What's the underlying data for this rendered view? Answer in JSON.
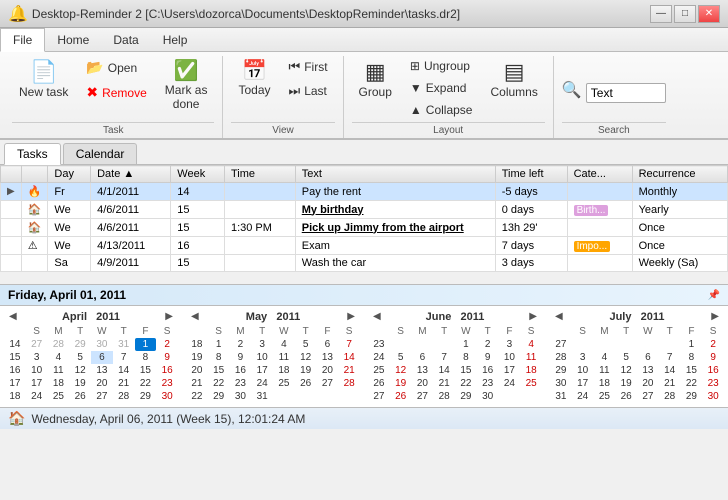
{
  "titleBar": {
    "icon": "🔔",
    "title": "Desktop-Reminder 2 [C:\\Users\\dozorca\\Documents\\DesktopReminder\\tasks.dr2]",
    "minimize": "—",
    "maximize": "□",
    "close": "✕"
  },
  "menuBar": {
    "items": [
      "File",
      "Home",
      "Data",
      "Help"
    ],
    "active": "Home"
  },
  "ribbon": {
    "groups": [
      {
        "label": "Task",
        "buttons": [
          {
            "id": "new-task",
            "icon": "📄",
            "label": "New task"
          },
          {
            "id": "open",
            "icon": "📂",
            "label": "Open",
            "small": true
          },
          {
            "id": "remove",
            "icon": "✖",
            "label": "Remove",
            "small": true,
            "color": "red"
          },
          {
            "id": "mark-done",
            "icon": "✔",
            "label": "Mark as done",
            "large": true
          }
        ]
      },
      {
        "label": "View",
        "buttons": [
          {
            "id": "today",
            "icon": "📅",
            "label": "Today",
            "large": true
          },
          {
            "id": "first",
            "icon": "⏮",
            "label": "First",
            "small": true
          },
          {
            "id": "last",
            "icon": "⏭",
            "label": "Last",
            "small": true
          }
        ]
      },
      {
        "label": "Layout",
        "buttons": [
          {
            "id": "group",
            "icon": "▦",
            "label": "Group",
            "large": true
          },
          {
            "id": "ungroup",
            "icon": "⊞",
            "label": "Ungroup",
            "small": true
          },
          {
            "id": "expand",
            "label": "Expand",
            "small": true
          },
          {
            "id": "collapse",
            "label": "Collapse",
            "small": true
          },
          {
            "id": "columns",
            "icon": "▤",
            "label": "Columns",
            "large": true
          }
        ]
      },
      {
        "label": "Search",
        "searchLabel": "Text",
        "searchPlaceholder": "Text"
      }
    ]
  },
  "tabs": [
    "Tasks",
    "Calendar"
  ],
  "activeTab": "Tasks",
  "tableHeaders": [
    "",
    "Day",
    "Date",
    "Week",
    "Time",
    "Text",
    "Time left",
    "Cate...",
    "Recurrence"
  ],
  "tasks": [
    {
      "indicator": "▶",
      "icon": "🔥",
      "day": "Fr",
      "date": "4/1/2011",
      "week": "14",
      "time": "",
      "text": "Pay the rent",
      "timeLeft": "-5 days",
      "category": "",
      "recurrence": "Monthly",
      "selected": true
    },
    {
      "indicator": "",
      "icon": "🏠",
      "day": "We",
      "date": "4/6/2011",
      "week": "15",
      "time": "",
      "text": "My birthday",
      "timeLeft": "0 days",
      "category": "Birth...",
      "recurrence": "Yearly",
      "bold": true,
      "underline": true
    },
    {
      "indicator": "",
      "icon": "🏠",
      "day": "We",
      "date": "4/6/2011",
      "week": "15",
      "time": "1:30 PM",
      "text": "Pick up Jimmy from the airport",
      "timeLeft": "13h 29'",
      "category": "",
      "recurrence": "Once",
      "bold": true,
      "underline": true
    },
    {
      "indicator": "",
      "icon": "⚠",
      "day": "We",
      "date": "4/13/2011",
      "week": "16",
      "time": "",
      "text": "Exam",
      "timeLeft": "7 days",
      "category": "Impo...",
      "recurrence": "Once"
    },
    {
      "indicator": "",
      "icon": "",
      "day": "Sa",
      "date": "4/9/2011",
      "week": "15",
      "time": "",
      "text": "Wash the car",
      "timeLeft": "3 days",
      "category": "",
      "recurrence": "Weekly (Sa)"
    }
  ],
  "calendarHeader": "Friday, April 01, 2011",
  "calendars": [
    {
      "month": "April",
      "year": "2011",
      "weekHeader": [
        "S",
        "M",
        "T",
        "W",
        "T",
        "F",
        "S"
      ],
      "weeks": [
        {
          "wn": "14",
          "days": [
            {
              "d": "27",
              "om": true
            },
            {
              "d": "28",
              "om": true
            },
            {
              "d": "29",
              "om": true
            },
            {
              "d": "30",
              "om": true
            },
            {
              "d": "31",
              "om": true
            },
            {
              "d": "1",
              "today": true
            },
            {
              "d": "2",
              "weekend": true
            }
          ]
        },
        {
          "wn": "15",
          "days": [
            {
              "d": "3"
            },
            {
              "d": "4"
            },
            {
              "d": "5"
            },
            {
              "d": "6",
              "sel": true
            },
            {
              "d": "7"
            },
            {
              "d": "8"
            },
            {
              "d": "9",
              "weekend": true
            }
          ]
        },
        {
          "wn": "16",
          "days": [
            {
              "d": "10"
            },
            {
              "d": "11"
            },
            {
              "d": "12"
            },
            {
              "d": "13"
            },
            {
              "d": "14"
            },
            {
              "d": "15"
            },
            {
              "d": "16",
              "weekend": true
            }
          ]
        },
        {
          "wn": "17",
          "days": [
            {
              "d": "17"
            },
            {
              "d": "18"
            },
            {
              "d": "19"
            },
            {
              "d": "20"
            },
            {
              "d": "21"
            },
            {
              "d": "22"
            },
            {
              "d": "23",
              "weekend": true
            }
          ]
        },
        {
          "wn": "18",
          "days": [
            {
              "d": "24"
            },
            {
              "d": "25"
            },
            {
              "d": "26"
            },
            {
              "d": "27"
            },
            {
              "d": "28"
            },
            {
              "d": "29"
            },
            {
              "d": "30",
              "weekend": true
            }
          ]
        }
      ]
    },
    {
      "month": "May",
      "year": "2011",
      "weekHeader": [
        "S",
        "M",
        "T",
        "W",
        "T",
        "F",
        "S"
      ],
      "weeks": [
        {
          "wn": "18",
          "days": [
            {
              "d": "1"
            },
            {
              "d": "2"
            },
            {
              "d": "3"
            },
            {
              "d": "4"
            },
            {
              "d": "5"
            },
            {
              "d": "6"
            },
            {
              "d": "7",
              "weekend": true
            }
          ]
        },
        {
          "wn": "19",
          "days": [
            {
              "d": "8"
            },
            {
              "d": "9"
            },
            {
              "d": "10"
            },
            {
              "d": "11"
            },
            {
              "d": "12"
            },
            {
              "d": "13"
            },
            {
              "d": "14",
              "weekend": true
            }
          ]
        },
        {
          "wn": "20",
          "days": [
            {
              "d": "15"
            },
            {
              "d": "16"
            },
            {
              "d": "17"
            },
            {
              "d": "18"
            },
            {
              "d": "19"
            },
            {
              "d": "20"
            },
            {
              "d": "21",
              "weekend": true
            }
          ]
        },
        {
          "wn": "21",
          "days": [
            {
              "d": "22"
            },
            {
              "d": "23"
            },
            {
              "d": "24"
            },
            {
              "d": "25"
            },
            {
              "d": "26"
            },
            {
              "d": "27"
            },
            {
              "d": "28",
              "weekend": true
            }
          ]
        },
        {
          "wn": "22",
          "days": [
            {
              "d": "29"
            },
            {
              "d": "30"
            },
            {
              "d": "31"
            },
            {
              "d": "",
              "om": true
            },
            {
              "d": "",
              "om": true
            },
            {
              "d": "",
              "om": true
            },
            {
              "d": "",
              "om": true
            }
          ]
        }
      ]
    },
    {
      "month": "June",
      "year": "2011",
      "weekHeader": [
        "S",
        "M",
        "T",
        "W",
        "T",
        "F",
        "S"
      ],
      "weeks": [
        {
          "wn": "23",
          "days": [
            {
              "d": ""
            },
            {
              "d": ""
            },
            {
              "d": ""
            },
            {
              "d": "1"
            },
            {
              "d": "2"
            },
            {
              "d": "3"
            },
            {
              "d": "4",
              "weekend": true
            }
          ]
        },
        {
          "wn": "24",
          "days": [
            {
              "d": "5"
            },
            {
              "d": "6"
            },
            {
              "d": "7"
            },
            {
              "d": "8"
            },
            {
              "d": "9"
            },
            {
              "d": "10"
            },
            {
              "d": "11",
              "weekend": true
            }
          ]
        },
        {
          "wn": "25",
          "days": [
            {
              "d": "12",
              "weekend": true
            },
            {
              "d": "13"
            },
            {
              "d": "14"
            },
            {
              "d": "15"
            },
            {
              "d": "16"
            },
            {
              "d": "17"
            },
            {
              "d": "18",
              "weekend": true
            }
          ]
        },
        {
          "wn": "26",
          "days": [
            {
              "d": "19",
              "weekend": true
            },
            {
              "d": "20"
            },
            {
              "d": "21"
            },
            {
              "d": "22"
            },
            {
              "d": "23"
            },
            {
              "d": "24"
            },
            {
              "d": "25",
              "weekend": true
            }
          ]
        },
        {
          "wn": "27",
          "days": [
            {
              "d": "26",
              "weekend": true
            },
            {
              "d": "27"
            },
            {
              "d": "28"
            },
            {
              "d": "29"
            },
            {
              "d": "30"
            },
            {
              "d": ""
            },
            {
              "d": ""
            }
          ]
        }
      ]
    },
    {
      "month": "July",
      "year": "2011",
      "weekHeader": [
        "S",
        "M",
        "T",
        "W",
        "T",
        "F",
        "S"
      ],
      "weeks": [
        {
          "wn": "27",
          "days": [
            {
              "d": ""
            },
            {
              "d": ""
            },
            {
              "d": ""
            },
            {
              "d": ""
            },
            {
              "d": ""
            },
            {
              "d": "1"
            },
            {
              "d": "2",
              "weekend": true
            }
          ]
        },
        {
          "wn": "28",
          "days": [
            {
              "d": "3"
            },
            {
              "d": "4"
            },
            {
              "d": "5"
            },
            {
              "d": "6"
            },
            {
              "d": "7"
            },
            {
              "d": "8"
            },
            {
              "d": "9",
              "weekend": true
            }
          ]
        },
        {
          "wn": "29",
          "days": [
            {
              "d": "10"
            },
            {
              "d": "11"
            },
            {
              "d": "12"
            },
            {
              "d": "13"
            },
            {
              "d": "14"
            },
            {
              "d": "15"
            },
            {
              "d": "16",
              "weekend": true
            }
          ]
        },
        {
          "wn": "30",
          "days": [
            {
              "d": "17"
            },
            {
              "d": "18"
            },
            {
              "d": "19"
            },
            {
              "d": "20"
            },
            {
              "d": "21"
            },
            {
              "d": "22"
            },
            {
              "d": "23",
              "weekend": true
            }
          ]
        },
        {
          "wn": "31",
          "days": [
            {
              "d": "24"
            },
            {
              "d": "25"
            },
            {
              "d": "26"
            },
            {
              "d": "27"
            },
            {
              "d": "28"
            },
            {
              "d": "29"
            },
            {
              "d": "30",
              "weekend": true
            }
          ]
        }
      ]
    }
  ],
  "statusBar": {
    "icon": "🏠",
    "text": "Wednesday, April 06, 2011 (Week 15), 12:01:24 AM"
  }
}
